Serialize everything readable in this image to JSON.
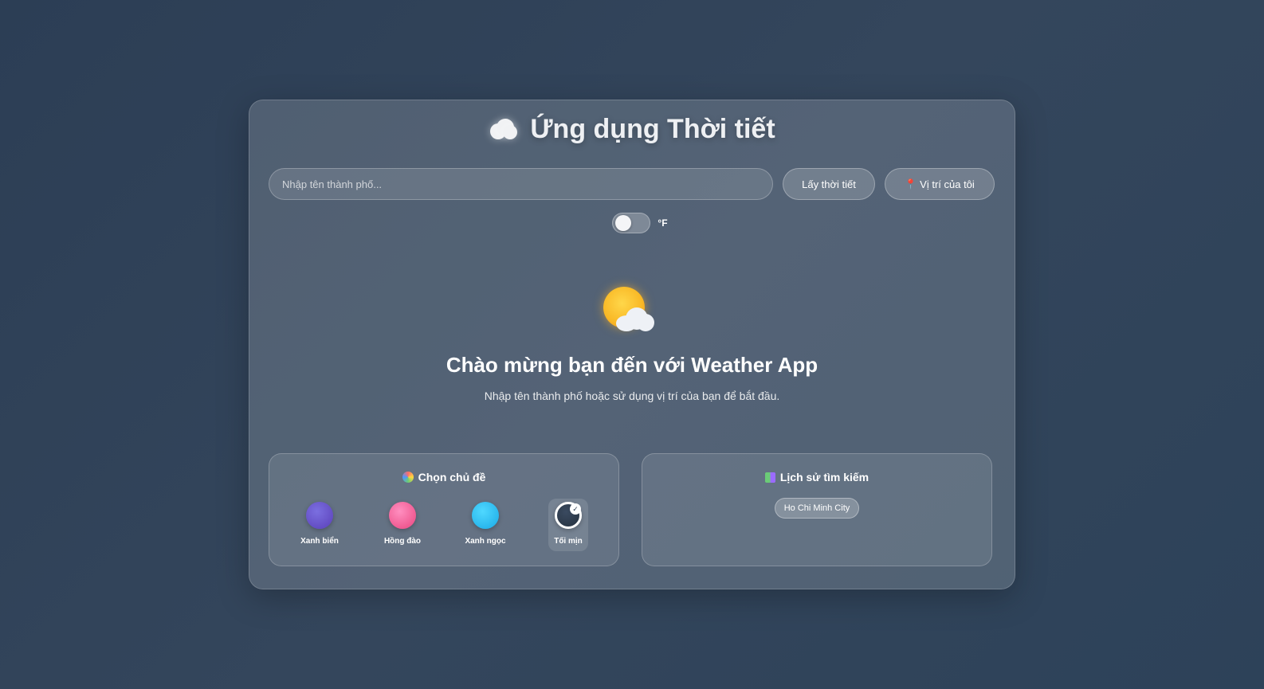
{
  "app": {
    "title": "Ứng dụng Thời tiết",
    "title_icon": "cloud-icon"
  },
  "search": {
    "placeholder": "Nhập tên thành phố...",
    "value": "",
    "get_weather_label": "Lấy thời tiết",
    "my_location_label": "Vị trí của tôi",
    "my_location_icon": "pin-icon"
  },
  "unit_toggle": {
    "label": "°F",
    "checked": false
  },
  "welcome": {
    "icon": "sun-behind-cloud-icon",
    "title": "Chào mừng bạn đến với Weather App",
    "subtitle": "Nhập tên thành phố hoặc sử dụng vị trí của bạn để bắt đầu."
  },
  "themes": {
    "title": "Chọn chủ đề",
    "icon": "palette-icon",
    "items": [
      {
        "label": "Xanh biển",
        "color_from": "#7b6fe0",
        "color_to": "#5a3fb8",
        "selected": false
      },
      {
        "label": "Hồng đào",
        "color_from": "#ff8fc0",
        "color_to": "#e9457f",
        "selected": false
      },
      {
        "label": "Xanh ngọc",
        "color_from": "#4fd8ff",
        "color_to": "#1aa9e6",
        "selected": false
      },
      {
        "label": "Tối mịn",
        "color_from": "#3a4a60",
        "color_to": "#26323f",
        "selected": true
      }
    ]
  },
  "history": {
    "title": "Lịch sử tìm kiếm",
    "icon": "history-icon",
    "items": [
      "Ho Chi Minh City"
    ]
  }
}
